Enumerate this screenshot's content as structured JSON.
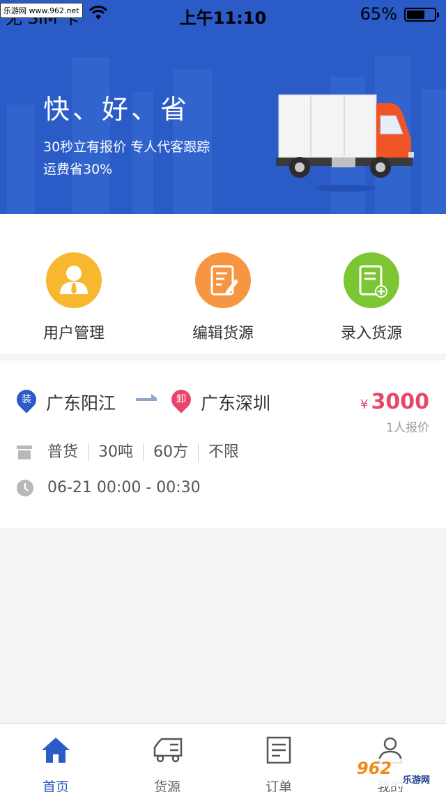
{
  "status_bar": {
    "carrier": "无 SIM 卡",
    "time": "上午11:10",
    "battery": "65%",
    "battery_level": 0.65,
    "watermark": "乐游网 www.962.net"
  },
  "banner": {
    "title": "快、好、省",
    "subtitle_line1": "30秒立有报价 专人代客跟踪",
    "subtitle_line2": "运费省30%",
    "colors": {
      "background": "#2a5bc6",
      "truck_cab": "#f05528"
    }
  },
  "actions": [
    {
      "label": "用户管理",
      "icon": "user-manager-icon",
      "color": "#f7b72e"
    },
    {
      "label": "编辑货源",
      "icon": "edit-document-icon",
      "color": "#f69542"
    },
    {
      "label": "录入货源",
      "icon": "add-document-icon",
      "color": "#7cc533"
    }
  ],
  "order": {
    "from_tag": "装",
    "from_city": "广东阳江",
    "to_tag": "卸",
    "to_city": "广东深圳",
    "price_symbol": "¥",
    "price": "3000",
    "quotes": "1人报价",
    "specs": [
      "普货",
      "30吨",
      "60方",
      "不限"
    ],
    "time": "06-21 00:00 - 00:30",
    "colors": {
      "from_pin": "#2a5bc6",
      "to_pin": "#e8466a",
      "price": "#e8466a"
    }
  },
  "tabbar": {
    "tabs": [
      {
        "label": "首页",
        "icon": "home-icon",
        "active": true
      },
      {
        "label": "货源",
        "icon": "truck-icon",
        "active": false
      },
      {
        "label": "订单",
        "icon": "document-icon",
        "active": false
      },
      {
        "label": "我的",
        "icon": "person-icon",
        "active": false
      }
    ],
    "active_color": "#2a5bc6"
  },
  "watermark_bottom": {
    "big": "962",
    "small": "乐游网"
  }
}
